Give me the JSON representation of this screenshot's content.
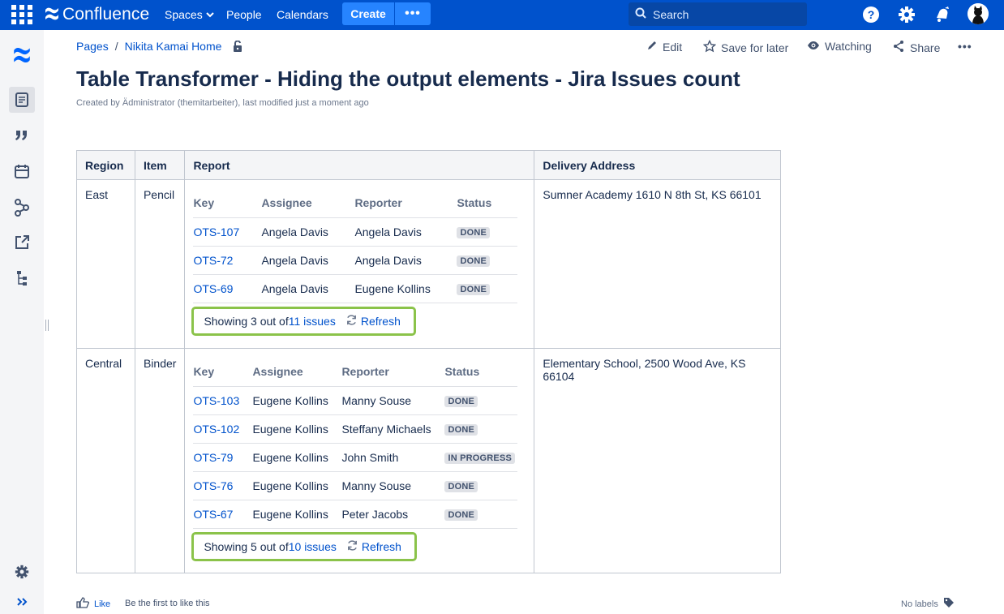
{
  "topnav": {
    "logo_text": "Confluence",
    "spaces": "Spaces",
    "people": "People",
    "calendars": "Calendars",
    "create": "Create",
    "more": "•••",
    "search_placeholder": "Search",
    "brand_color": "#0052cc"
  },
  "breadcrumb": {
    "pages": "Pages",
    "sep": "/",
    "home": "Nikita Kamai Home"
  },
  "actions": {
    "edit": "Edit",
    "save": "Save for later",
    "watching": "Watching",
    "share": "Share",
    "more": "•••"
  },
  "page": {
    "title": "Table Transformer - Hiding the output elements - Jira Issues count",
    "byline": "Created by Ädministrator (themitarbeiter), last modified just a moment ago"
  },
  "table": {
    "headers": [
      "Region",
      "Item",
      "Report",
      "Delivery Address"
    ],
    "jira_headers": [
      "Key",
      "Assignee",
      "Reporter",
      "Status"
    ],
    "rows": [
      {
        "region": "East",
        "item": "Pencil",
        "address": "Sumner Academy 1610 N 8th St, KS 66101",
        "issues": [
          {
            "key": "OTS-107",
            "assignee": "Angela Davis",
            "reporter": "Angela Davis",
            "status": "DONE"
          },
          {
            "key": "OTS-72",
            "assignee": "Angela Davis",
            "reporter": "Angela Davis",
            "status": "DONE"
          },
          {
            "key": "OTS-69",
            "assignee": "Angela Davis",
            "reporter": "Eugene Kollins",
            "status": "DONE"
          }
        ],
        "count_prefix": "Showing 3 out of ",
        "count_link": "11 issues",
        "refresh": "Refresh"
      },
      {
        "region": "Central",
        "item": "Binder",
        "address": "Elementary School, 2500 Wood Ave, KS 66104",
        "issues": [
          {
            "key": "OTS-103",
            "assignee": "Eugene Kollins",
            "reporter": "Manny Souse",
            "status": "DONE"
          },
          {
            "key": "OTS-102",
            "assignee": "Eugene Kollins",
            "reporter": "Steffany Michaels",
            "status": "DONE"
          },
          {
            "key": "OTS-79",
            "assignee": "Eugene Kollins",
            "reporter": "John Smith",
            "status": "IN PROGRESS"
          },
          {
            "key": "OTS-76",
            "assignee": "Eugene Kollins",
            "reporter": "Manny Souse",
            "status": "DONE"
          },
          {
            "key": "OTS-67",
            "assignee": "Eugene Kollins",
            "reporter": "Peter Jacobs",
            "status": "DONE"
          }
        ],
        "count_prefix": "Showing 5 out of ",
        "count_link": "10 issues",
        "refresh": "Refresh"
      }
    ]
  },
  "footer": {
    "like": "Like",
    "first": "Be the first to like this",
    "labels": "No labels"
  },
  "highlight_color": "#8bc34a"
}
